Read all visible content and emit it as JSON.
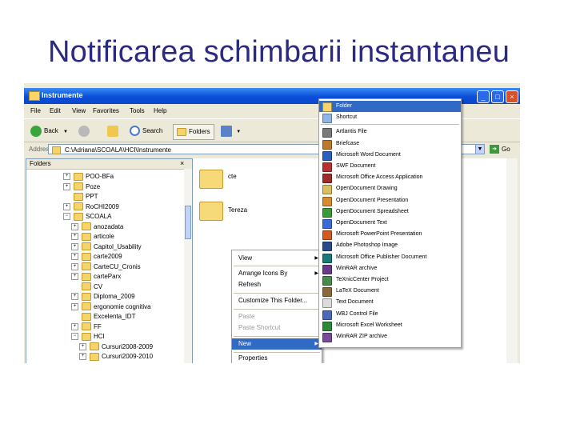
{
  "slide_title": "Notificarea schimbarii instantaneu",
  "window": {
    "title": "Instrumente",
    "minimize": "_",
    "maximize": "□",
    "close": "×"
  },
  "menu": [
    "File",
    "Edit",
    "View",
    "Favorites",
    "Tools",
    "Help"
  ],
  "toolbar": {
    "back": "Back",
    "search": "Search",
    "folders": "Folders"
  },
  "address": {
    "label": "Address",
    "path": "C:\\Adriana\\SCOALA\\HCI\\Instrumente",
    "go": "Go"
  },
  "folders_pane": {
    "header": "Folders",
    "close": "×",
    "items": [
      {
        "label": "POO-BFa",
        "indent": 0,
        "exp": "+"
      },
      {
        "label": "Poze",
        "indent": 0,
        "exp": "+"
      },
      {
        "label": "PPT",
        "indent": 0,
        "exp": ""
      },
      {
        "label": "RoCHI2009",
        "indent": 0,
        "exp": "+"
      },
      {
        "label": "SCOALA",
        "indent": 0,
        "exp": "−"
      },
      {
        "label": "anozadata",
        "indent": 1,
        "exp": "+"
      },
      {
        "label": "articole",
        "indent": 1,
        "exp": "+"
      },
      {
        "label": "Capitol_Usability",
        "indent": 1,
        "exp": "+"
      },
      {
        "label": "carte2009",
        "indent": 1,
        "exp": "+"
      },
      {
        "label": "CarteCU_Cronis",
        "indent": 1,
        "exp": "+"
      },
      {
        "label": "carteParx",
        "indent": 1,
        "exp": "+"
      },
      {
        "label": "CV",
        "indent": 1,
        "exp": ""
      },
      {
        "label": "Diploma_2009",
        "indent": 1,
        "exp": "+"
      },
      {
        "label": "ergonomie cognitiva",
        "indent": 1,
        "exp": "+"
      },
      {
        "label": "Excelenta_IDT",
        "indent": 1,
        "exp": ""
      },
      {
        "label": "FF",
        "indent": 1,
        "exp": "+"
      },
      {
        "label": "HCI",
        "indent": 1,
        "exp": "−"
      },
      {
        "label": "Cursuri2008-2009",
        "indent": 2,
        "exp": "+"
      },
      {
        "label": "Cursuri2009-2010",
        "indent": 2,
        "exp": "+"
      }
    ]
  },
  "content": {
    "folders": [
      "cte",
      "Tereza"
    ]
  },
  "context_menu": {
    "items": [
      {
        "label": "View",
        "arrow": "▶",
        "state": ""
      },
      {
        "label": "Arrange Icons By",
        "arrow": "▶",
        "state": ""
      },
      {
        "label": "Refresh",
        "arrow": "",
        "state": ""
      },
      {
        "label": "Customize This Folder...",
        "arrow": "",
        "state": ""
      },
      {
        "label": "Paste",
        "arrow": "",
        "state": "disabled"
      },
      {
        "label": "Paste Shortcut",
        "arrow": "",
        "state": "disabled"
      },
      {
        "label": "New",
        "arrow": "▶",
        "state": "active"
      },
      {
        "label": "Properties",
        "arrow": "",
        "state": ""
      }
    ]
  },
  "new_submenu": {
    "items": [
      {
        "label": "Folder",
        "color": "#f4d46b",
        "state": "active"
      },
      {
        "label": "Shortcut",
        "color": "#8fb4e8",
        "state": ""
      },
      {
        "label": "Artlantis File",
        "color": "#7a7a7a",
        "state": ""
      },
      {
        "label": "Briefcase",
        "color": "#c0782a",
        "state": ""
      },
      {
        "label": "Microsoft Word Document",
        "color": "#2b5fbf",
        "state": ""
      },
      {
        "label": "SWF Document",
        "color": "#b83030",
        "state": ""
      },
      {
        "label": "Microsoft Office Access Application",
        "color": "#a02b2b",
        "state": ""
      },
      {
        "label": "OpenDocument Drawing",
        "color": "#d8c060",
        "state": ""
      },
      {
        "label": "OpenDocument Presentation",
        "color": "#d88a30",
        "state": ""
      },
      {
        "label": "OpenDocument Spreadsheet",
        "color": "#3a9a3a",
        "state": ""
      },
      {
        "label": "OpenDocument Text",
        "color": "#3a6ad8",
        "state": ""
      },
      {
        "label": "Microsoft PowerPoint Presentation",
        "color": "#d05a20",
        "state": ""
      },
      {
        "label": "Adobe Photoshop Image",
        "color": "#2a4a8a",
        "state": ""
      },
      {
        "label": "Microsoft Office Publisher Document",
        "color": "#1a7a7a",
        "state": ""
      },
      {
        "label": "WinRAR archive",
        "color": "#6a3a8a",
        "state": ""
      },
      {
        "label": "TeXnicCenter Project",
        "color": "#4a8a4a",
        "state": ""
      },
      {
        "label": "LaTeX Document",
        "color": "#8a6a3a",
        "state": ""
      },
      {
        "label": "Text Document",
        "color": "#dcdcdc",
        "state": ""
      },
      {
        "label": "WBJ Control File",
        "color": "#4a6ab8",
        "state": ""
      },
      {
        "label": "Microsoft Excel Worksheet",
        "color": "#2a8a3a",
        "state": ""
      },
      {
        "label": "WinRAR ZIP archive",
        "color": "#7a4a9a",
        "state": ""
      }
    ]
  }
}
